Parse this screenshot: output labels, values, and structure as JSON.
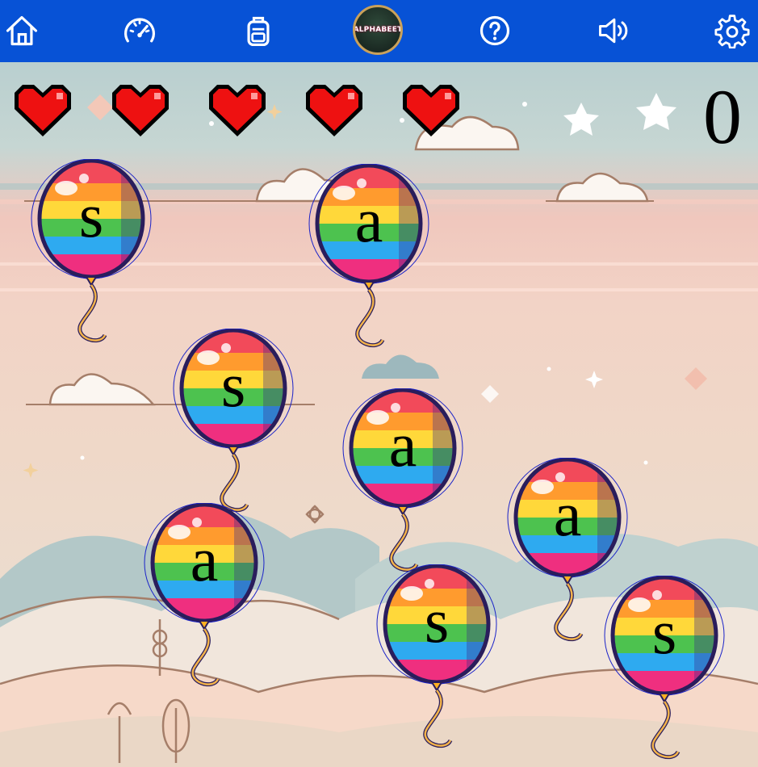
{
  "toolbar": {
    "items": [
      {
        "icon": "home-icon"
      },
      {
        "icon": "speedometer-icon"
      },
      {
        "icon": "backpack-icon"
      },
      {
        "icon": "help-icon"
      },
      {
        "icon": "volume-icon"
      },
      {
        "icon": "settings-icon"
      }
    ],
    "logo_text": "ALPHABEET",
    "bar_color": "#0752d6"
  },
  "game": {
    "lives": 5,
    "score": "0",
    "balloons": [
      {
        "letter": "s"
      },
      {
        "letter": "a"
      },
      {
        "letter": "s"
      },
      {
        "letter": "a"
      },
      {
        "letter": "a"
      },
      {
        "letter": "a"
      },
      {
        "letter": "s"
      },
      {
        "letter": "s"
      }
    ]
  }
}
